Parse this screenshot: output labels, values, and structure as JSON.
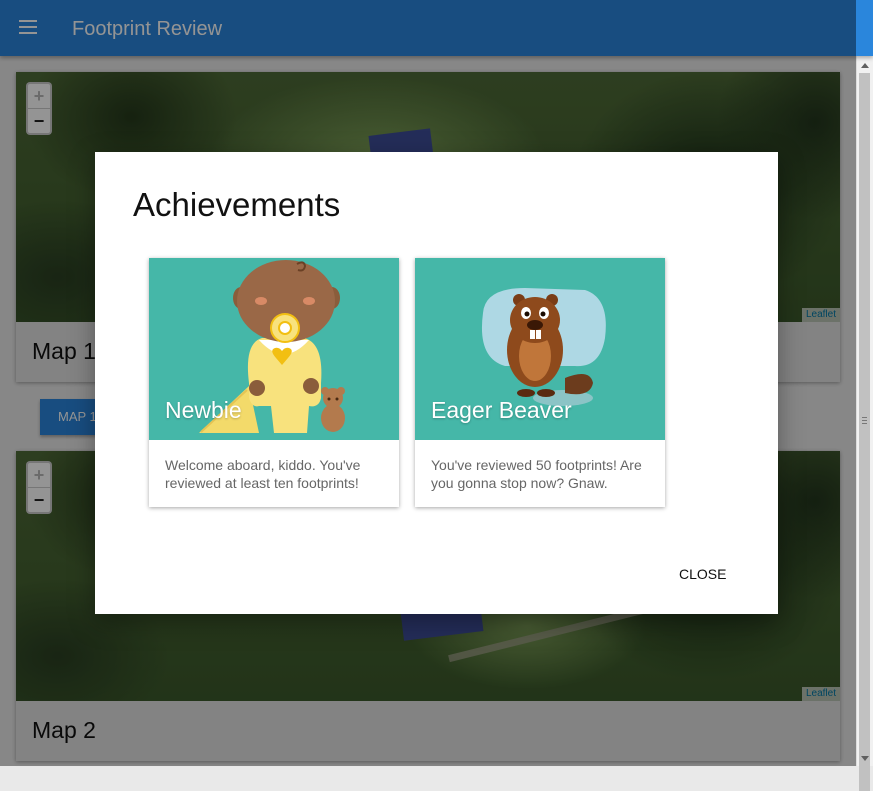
{
  "app": {
    "title": "Footprint Review",
    "menu_icon": "menu-icon"
  },
  "maps": [
    {
      "title": "Map 1",
      "zoom_in": "+",
      "zoom_out": "−",
      "attribution": "Leaflet"
    },
    {
      "title": "Map 2",
      "zoom_in": "+",
      "zoom_out": "−",
      "attribution": "Leaflet"
    }
  ],
  "map_button": {
    "label": "MAP 1"
  },
  "dialog": {
    "title": "Achievements",
    "achievements": [
      {
        "name": "Newbie",
        "description": "Welcome aboard, kiddo. You've reviewed at least ten footprints!",
        "image": "baby-icon"
      },
      {
        "name": "Eager Beaver",
        "description": "You've reviewed 50 footprints! Are you gonna stop now? Gnaw.",
        "image": "beaver-icon"
      }
    ],
    "close_label": "CLOSE"
  },
  "colors": {
    "app_bar": "#2a86dc",
    "card_teal": "#45b7a8",
    "attribution_link": "#0078a8"
  }
}
